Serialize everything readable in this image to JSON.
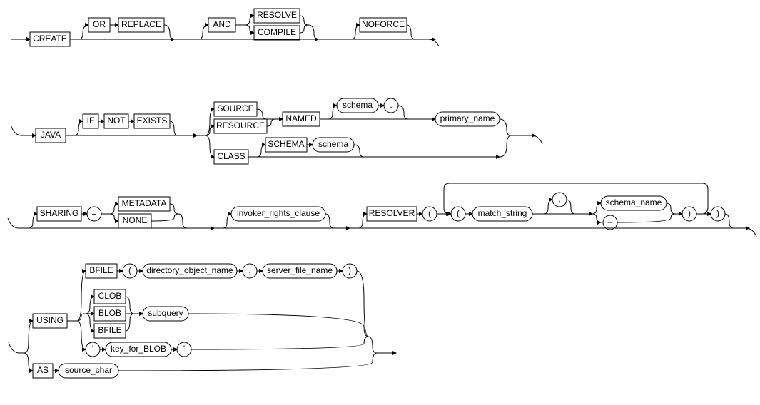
{
  "diagram": {
    "row1": {
      "create": "CREATE",
      "or": "OR",
      "replace": "REPLACE",
      "and": "AND",
      "resolve": "RESOLVE",
      "compile": "COMPILE",
      "noforce": "NOFORCE"
    },
    "row2": {
      "java": "JAVA",
      "if": "IF",
      "not": "NOT",
      "exists": "EXISTS",
      "source": "SOURCE",
      "resource": "RESOURCE",
      "named": "NAMED",
      "schema": "schema",
      "dot": ".",
      "primary_name": "primary_name",
      "class": "CLASS",
      "schema_kw": "SCHEMA",
      "schema2": "schema"
    },
    "row3": {
      "sharing": "SHARING",
      "eq": "=",
      "metadata": "METADATA",
      "none": "NONE",
      "invoker_rights_clause": "invoker_rights_clause",
      "resolver": "RESOLVER",
      "lp": "(",
      "lp2": "(",
      "match_string": "match_string",
      "comma": ",",
      "schema_name": "schema_name",
      "dash": "–",
      "rp": ")",
      "rp2": ")"
    },
    "row4": {
      "using": "USING",
      "bfile": "BFILE",
      "lp": "(",
      "directory_object_name": "directory_object_name",
      "comma": ",",
      "server_file_name": "server_file_name",
      "rp": ")",
      "clob": "CLOB",
      "blob": "BLOB",
      "bfile2": "BFILE",
      "subquery": "subquery",
      "sq1": "'",
      "key_for_blob": "key_for_BLOB",
      "sq2": "'",
      "as": "AS",
      "source_char": "source_char"
    }
  }
}
